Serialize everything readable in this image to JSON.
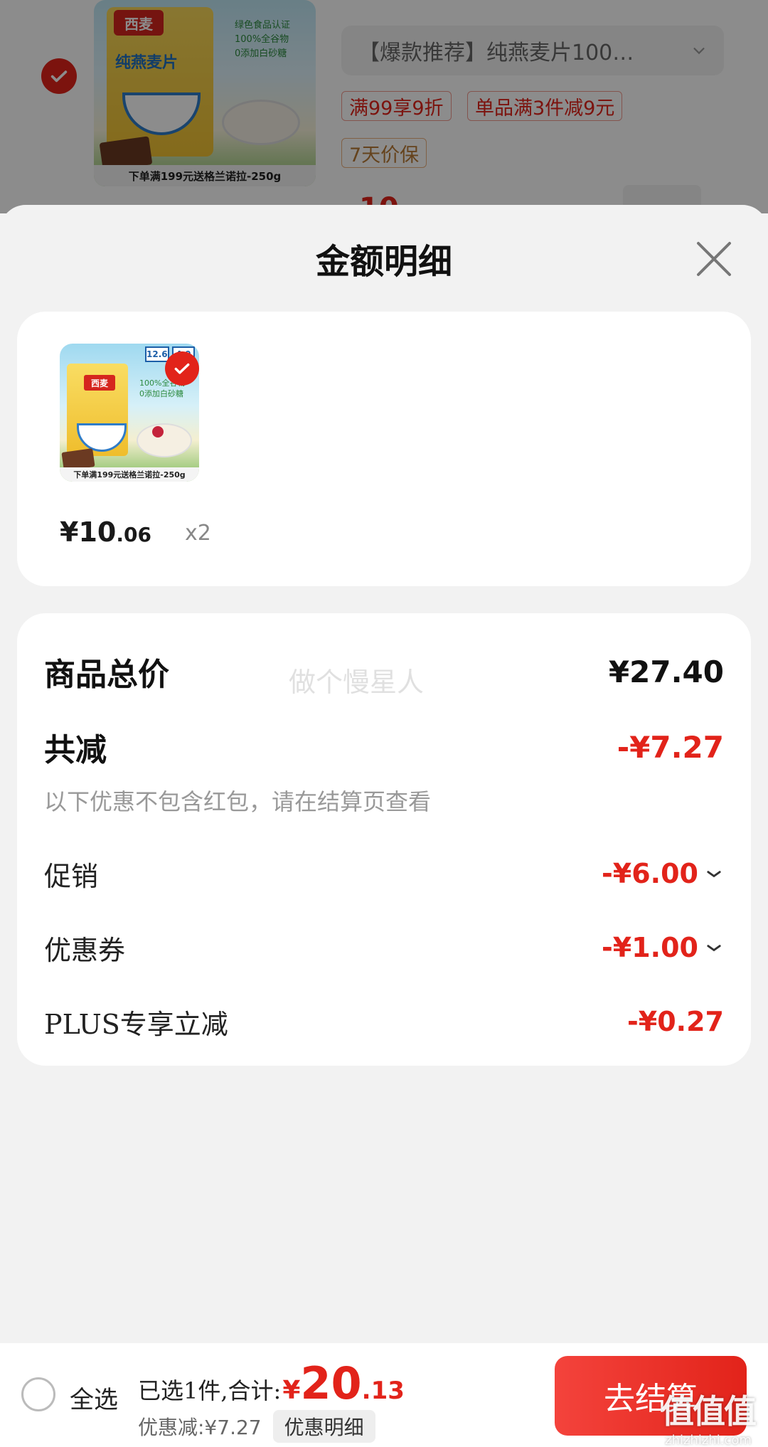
{
  "background_cart": {
    "sku_selector": "【爆款推荐】纯燕麦片100…",
    "tags": [
      "满99享9折",
      "单品满3件减9元",
      "7天价保"
    ],
    "product_image": {
      "brand": "西麦",
      "name": "纯燕麦片",
      "labels": [
        "绿色食品认证",
        "100%全谷物",
        "0添加白砂糖"
      ],
      "banner": "下单满199元送格兰诺拉-250g"
    },
    "price_fragment": "10"
  },
  "sheet": {
    "title": "金额明细",
    "product": {
      "thumb_brand": "西麦",
      "thumb_nutri": [
        "12.6",
        "4.0"
      ],
      "thumb_labels": [
        "100%全谷物",
        "0添加白砂糖"
      ],
      "thumb_banner": "下单满199元送格兰诺拉-250g",
      "price_int": "¥10",
      "price_dec": ".06",
      "quantity": "x2"
    },
    "summary": {
      "total_label": "商品总价",
      "total_value": "¥27.40",
      "discount_label": "共减",
      "discount_value": "-¥7.27",
      "note": "以下优惠不包含红包，请在结算页查看",
      "promo_label": "促销",
      "promo_value": "-¥6.00",
      "coupon_label": "优惠券",
      "coupon_value": "-¥1.00",
      "plus_label": "PLUS专享立减",
      "plus_value": "-¥0.27",
      "watermark": "做个慢星人"
    }
  },
  "bottom_bar": {
    "select_all": "全选",
    "selected_text": "已选1件,合计:",
    "currency": "¥",
    "total_int": "20",
    "total_dec": ".13",
    "saved": "优惠减:¥7.27",
    "detail_button": "优惠明细",
    "checkout_button": "去结算"
  },
  "site_mark": {
    "glyphs": "值值值",
    "url": "zhizhizhi.com"
  },
  "colors": {
    "accent_red": "#e2231a",
    "text_gray": "#999999",
    "card_bg": "#ffffff",
    "page_bg": "#f2f2f2"
  }
}
